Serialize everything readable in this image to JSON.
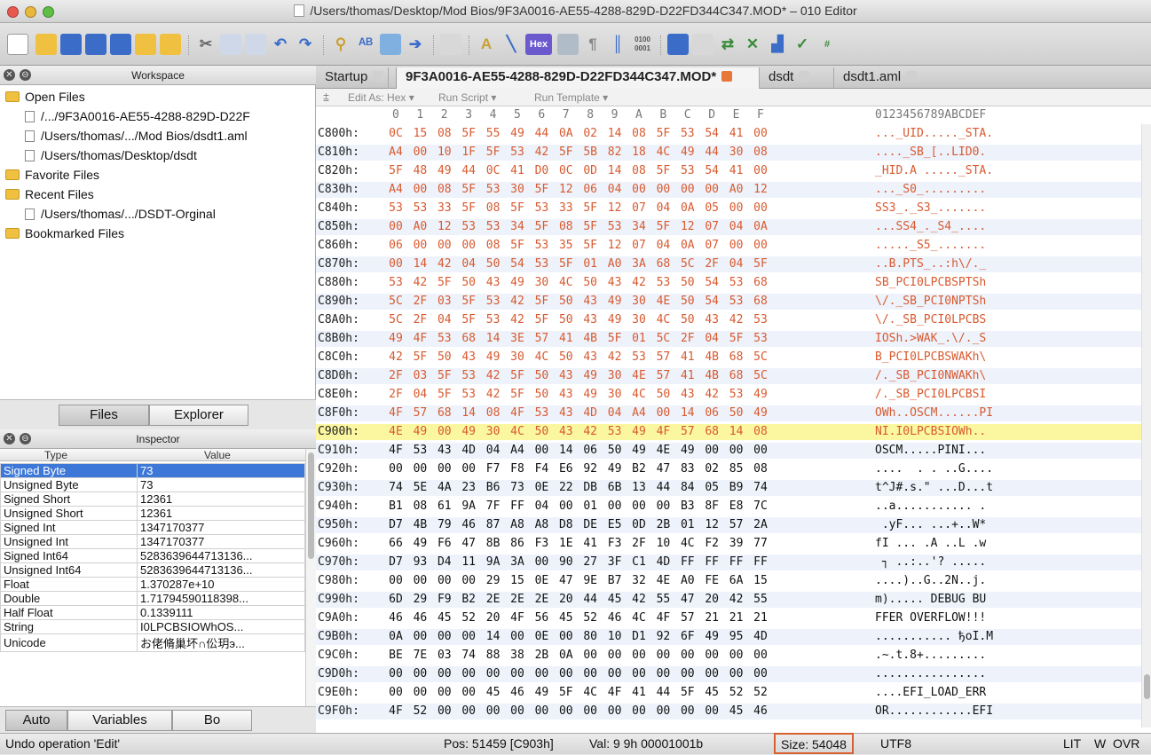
{
  "window": {
    "title": "/Users/thomas/Desktop/Mod Bios/9F3A0016-AE55-4288-829D-D22FD344C347.MOD* – 010 Editor"
  },
  "toolbar": {
    "icons": [
      "new-file-icon",
      "open-file-icon",
      "save-icon",
      "save-all-icon",
      "workspace-icon",
      "open-folder-icon",
      "folder-icon",
      "cut-icon",
      "copy-icon",
      "paste-icon",
      "undo-icon",
      "redo-icon",
      "find-icon",
      "replace-icon",
      "goto-icon",
      "arrow-icon",
      "print-icon",
      "font-icon",
      "highlight-icon",
      "hex-icon",
      "compare-icon",
      "paragraph-icon",
      "columns-icon",
      "binary-icon",
      "calculator-icon",
      "template-icon",
      "script-icon",
      "tools-icon",
      "histogram-icon",
      "checksum-icon",
      "convert-icon"
    ],
    "hex_label": "Hex",
    "binary_label": "0100\n0001"
  },
  "workspace": {
    "title": "Workspace",
    "open_files_label": "Open Files",
    "open_files": [
      "/.../9F3A0016-AE55-4288-829D-D22F",
      "/Users/thomas/.../Mod Bios/dsdt1.aml",
      "/Users/thomas/Desktop/dsdt"
    ],
    "favorite_label": "Favorite Files",
    "recent_label": "Recent Files",
    "recent_files": [
      "/Users/thomas/.../DSDT-Orginal"
    ],
    "bookmarked_label": "Bookmarked Files",
    "tabs": [
      "Files",
      "Explorer"
    ]
  },
  "inspector": {
    "title": "Inspector",
    "col_type": "Type",
    "col_value": "Value",
    "rows": [
      {
        "type": "Signed Byte",
        "value": "73"
      },
      {
        "type": "Unsigned Byte",
        "value": "73"
      },
      {
        "type": "Signed Short",
        "value": "12361"
      },
      {
        "type": "Unsigned Short",
        "value": "12361"
      },
      {
        "type": "Signed Int",
        "value": "1347170377"
      },
      {
        "type": "Unsigned Int",
        "value": "1347170377"
      },
      {
        "type": "Signed Int64",
        "value": "5283639644713136..."
      },
      {
        "type": "Unsigned Int64",
        "value": "5283639644713136..."
      },
      {
        "type": "Float",
        "value": "1.370287e+10"
      },
      {
        "type": "Double",
        "value": "1.71794590118398..."
      },
      {
        "type": "Half Float",
        "value": "0.1339111"
      },
      {
        "type": "String",
        "value": "I0LPCBSIOWhOS..."
      },
      {
        "type": "Unicode",
        "value": "お佬脩巢坏∩伀玥э..."
      }
    ],
    "tabs": [
      "Auto",
      "Variables",
      "Bo"
    ]
  },
  "editor": {
    "tabs": [
      "Startup",
      "9F3A0016-AE55-4288-829D-D22FD344C347.MOD*",
      "dsdt",
      "dsdt1.aml"
    ],
    "edit_as": "Edit As: Hex ▾",
    "run_script": "Run Script ▾",
    "run_template": "Run Template ▾",
    "col_headers": [
      "0",
      "1",
      "2",
      "3",
      "4",
      "5",
      "6",
      "7",
      "8",
      "9",
      "A",
      "B",
      "C",
      "D",
      "E",
      "F"
    ],
    "ascii_header": "0123456789ABCDEF",
    "rows": [
      {
        "addr": "C800h:",
        "bytes": [
          "0C",
          "15",
          "08",
          "5F",
          "55",
          "49",
          "44",
          "0A",
          "02",
          "14",
          "08",
          "5F",
          "53",
          "54",
          "41",
          "00"
        ],
        "ascii": "..._UID....._STA."
      },
      {
        "addr": "C810h:",
        "bytes": [
          "A4",
          "00",
          "10",
          "1F",
          "5F",
          "53",
          "42",
          "5F",
          "5B",
          "82",
          "18",
          "4C",
          "49",
          "44",
          "30",
          "08"
        ],
        "ascii": "...._SB_[..LID0."
      },
      {
        "addr": "C820h:",
        "bytes": [
          "5F",
          "48",
          "49",
          "44",
          "0C",
          "41",
          "D0",
          "0C",
          "0D",
          "14",
          "08",
          "5F",
          "53",
          "54",
          "41",
          "00"
        ],
        "ascii": "_HID.A ....._STA."
      },
      {
        "addr": "C830h:",
        "bytes": [
          "A4",
          "00",
          "08",
          "5F",
          "53",
          "30",
          "5F",
          "12",
          "06",
          "04",
          "00",
          "00",
          "00",
          "00",
          "A0",
          "12"
        ],
        "ascii": "..._S0_........."
      },
      {
        "addr": "C840h:",
        "bytes": [
          "53",
          "53",
          "33",
          "5F",
          "08",
          "5F",
          "53",
          "33",
          "5F",
          "12",
          "07",
          "04",
          "0A",
          "05",
          "00",
          "00"
        ],
        "ascii": "SS3_._S3_......."
      },
      {
        "addr": "C850h:",
        "bytes": [
          "00",
          "A0",
          "12",
          "53",
          "53",
          "34",
          "5F",
          "08",
          "5F",
          "53",
          "34",
          "5F",
          "12",
          "07",
          "04",
          "0A"
        ],
        "ascii": "...SS4_._S4_...."
      },
      {
        "addr": "C860h:",
        "bytes": [
          "06",
          "00",
          "00",
          "00",
          "08",
          "5F",
          "53",
          "35",
          "5F",
          "12",
          "07",
          "04",
          "0A",
          "07",
          "00",
          "00"
        ],
        "ascii": "....._S5_......."
      },
      {
        "addr": "C870h:",
        "bytes": [
          "00",
          "14",
          "42",
          "04",
          "50",
          "54",
          "53",
          "5F",
          "01",
          "A0",
          "3A",
          "68",
          "5C",
          "2F",
          "04",
          "5F"
        ],
        "ascii": "..B.PTS_..:h\\/._"
      },
      {
        "addr": "C880h:",
        "bytes": [
          "53",
          "42",
          "5F",
          "50",
          "43",
          "49",
          "30",
          "4C",
          "50",
          "43",
          "42",
          "53",
          "50",
          "54",
          "53",
          "68"
        ],
        "ascii": "SB_PCI0LPCBSPTSh"
      },
      {
        "addr": "C890h:",
        "bytes": [
          "5C",
          "2F",
          "03",
          "5F",
          "53",
          "42",
          "5F",
          "50",
          "43",
          "49",
          "30",
          "4E",
          "50",
          "54",
          "53",
          "68"
        ],
        "ascii": "\\/._SB_PCI0NPTSh"
      },
      {
        "addr": "C8A0h:",
        "bytes": [
          "5C",
          "2F",
          "04",
          "5F",
          "53",
          "42",
          "5F",
          "50",
          "43",
          "49",
          "30",
          "4C",
          "50",
          "43",
          "42",
          "53"
        ],
        "ascii": "\\/._SB_PCI0LPCBS"
      },
      {
        "addr": "C8B0h:",
        "bytes": [
          "49",
          "4F",
          "53",
          "68",
          "14",
          "3E",
          "57",
          "41",
          "4B",
          "5F",
          "01",
          "5C",
          "2F",
          "04",
          "5F",
          "53"
        ],
        "ascii": "IOSh.>WAK_.\\/._S"
      },
      {
        "addr": "C8C0h:",
        "bytes": [
          "42",
          "5F",
          "50",
          "43",
          "49",
          "30",
          "4C",
          "50",
          "43",
          "42",
          "53",
          "57",
          "41",
          "4B",
          "68",
          "5C"
        ],
        "ascii": "B_PCI0LPCBSWAKh\\"
      },
      {
        "addr": "C8D0h:",
        "bytes": [
          "2F",
          "03",
          "5F",
          "53",
          "42",
          "5F",
          "50",
          "43",
          "49",
          "30",
          "4E",
          "57",
          "41",
          "4B",
          "68",
          "5C"
        ],
        "ascii": "/._SB_PCI0NWAKh\\"
      },
      {
        "addr": "C8E0h:",
        "bytes": [
          "2F",
          "04",
          "5F",
          "53",
          "42",
          "5F",
          "50",
          "43",
          "49",
          "30",
          "4C",
          "50",
          "43",
          "42",
          "53",
          "49"
        ],
        "ascii": "/._SB_PCI0LPCBSI"
      },
      {
        "addr": "C8F0h:",
        "bytes": [
          "4F",
          "57",
          "68",
          "14",
          "08",
          "4F",
          "53",
          "43",
          "4D",
          "04",
          "A4",
          "00",
          "14",
          "06",
          "50",
          "49"
        ],
        "ascii": "OWh..OSCM......PI"
      },
      {
        "addr": "C900h:",
        "bytes": [
          "4E",
          "49",
          "00",
          "49",
          "30",
          "4C",
          "50",
          "43",
          "42",
          "53",
          "49",
          "4F",
          "57",
          "68",
          "14",
          "08"
        ],
        "ascii": "NI.I0LPCBSIOWh.."
      },
      {
        "addr": "C910h:",
        "bytes": [
          "4F",
          "53",
          "43",
          "4D",
          "04",
          "A4",
          "00",
          "14",
          "06",
          "50",
          "49",
          "4E",
          "49",
          "00",
          "00",
          "00"
        ],
        "ascii": "OSCM.....PINI..."
      },
      {
        "addr": "C920h:",
        "bytes": [
          "00",
          "00",
          "00",
          "00",
          "F7",
          "F8",
          "F4",
          "E6",
          "92",
          "49",
          "B2",
          "47",
          "83",
          "02",
          "85",
          "08"
        ],
        "ascii": "....  . . ..G...."
      },
      {
        "addr": "C930h:",
        "bytes": [
          "74",
          "5E",
          "4A",
          "23",
          "B6",
          "73",
          "0E",
          "22",
          "DB",
          "6B",
          "13",
          "44",
          "84",
          "05",
          "B9",
          "74"
        ],
        "ascii": "t^J#.s.\" ...D...t"
      },
      {
        "addr": "C940h:",
        "bytes": [
          "B1",
          "08",
          "61",
          "9A",
          "7F",
          "FF",
          "04",
          "00",
          "01",
          "00",
          "00",
          "00",
          "B3",
          "8F",
          "E8",
          "7C"
        ],
        "ascii": "..a........... ."
      },
      {
        "addr": "C950h:",
        "bytes": [
          "D7",
          "4B",
          "79",
          "46",
          "87",
          "A8",
          "A8",
          "D8",
          "DE",
          "E5",
          "0D",
          "2B",
          "01",
          "12",
          "57",
          "2A"
        ],
        "ascii": " .yF... ...+..W*"
      },
      {
        "addr": "C960h:",
        "bytes": [
          "66",
          "49",
          "F6",
          "47",
          "8B",
          "86",
          "F3",
          "1E",
          "41",
          "F3",
          "2F",
          "10",
          "4C",
          "F2",
          "39",
          "77"
        ],
        "ascii": "fI ... .A ..L .w"
      },
      {
        "addr": "C970h:",
        "bytes": [
          "D7",
          "93",
          "D4",
          "11",
          "9A",
          "3A",
          "00",
          "90",
          "27",
          "3F",
          "C1",
          "4D",
          "FF",
          "FF",
          "FF",
          "FF"
        ],
        "ascii": " ┐ ..:..'? ....."
      },
      {
        "addr": "C980h:",
        "bytes": [
          "00",
          "00",
          "00",
          "00",
          "29",
          "15",
          "0E",
          "47",
          "9E",
          "B7",
          "32",
          "4E",
          "A0",
          "FE",
          "6A",
          "15"
        ],
        "ascii": "....)..G..2N..j."
      },
      {
        "addr": "C990h:",
        "bytes": [
          "6D",
          "29",
          "F9",
          "B2",
          "2E",
          "2E",
          "2E",
          "20",
          "44",
          "45",
          "42",
          "55",
          "47",
          "20",
          "42",
          "55"
        ],
        "ascii": "m)..... DEBUG BU"
      },
      {
        "addr": "C9A0h:",
        "bytes": [
          "46",
          "46",
          "45",
          "52",
          "20",
          "4F",
          "56",
          "45",
          "52",
          "46",
          "4C",
          "4F",
          "57",
          "21",
          "21",
          "21"
        ],
        "ascii": "FFER OVERFLOW!!!"
      },
      {
        "addr": "C9B0h:",
        "bytes": [
          "0A",
          "00",
          "00",
          "00",
          "14",
          "00",
          "0E",
          "00",
          "80",
          "10",
          "D1",
          "92",
          "6F",
          "49",
          "95",
          "4D"
        ],
        "ascii": "........... ђoI.M"
      },
      {
        "addr": "C9C0h:",
        "bytes": [
          "BE",
          "7E",
          "03",
          "74",
          "88",
          "38",
          "2B",
          "0A",
          "00",
          "00",
          "00",
          "00",
          "00",
          "00",
          "00",
          "00"
        ],
        "ascii": ".~.t.8+........."
      },
      {
        "addr": "C9D0h:",
        "bytes": [
          "00",
          "00",
          "00",
          "00",
          "00",
          "00",
          "00",
          "00",
          "00",
          "00",
          "00",
          "00",
          "00",
          "00",
          "00",
          "00"
        ],
        "ascii": "................"
      },
      {
        "addr": "C9E0h:",
        "bytes": [
          "00",
          "00",
          "00",
          "00",
          "45",
          "46",
          "49",
          "5F",
          "4C",
          "4F",
          "41",
          "44",
          "5F",
          "45",
          "52",
          "52"
        ],
        "ascii": "....EFI_LOAD_ERR"
      },
      {
        "addr": "C9F0h:",
        "bytes": [
          "4F",
          "52",
          "00",
          "00",
          "00",
          "00",
          "00",
          "00",
          "00",
          "00",
          "00",
          "00",
          "00",
          "00",
          "45",
          "46",
          "49"
        ],
        "ascii": "OR............EFI"
      }
    ]
  },
  "statusbar": {
    "message": "Undo operation 'Edit'",
    "pos": "Pos: 51459 [C903h]",
    "val": "Val: 9 9h 00001001b",
    "size": "Size: 54048",
    "encoding": "UTF8",
    "endian": "LIT",
    "mode_w": "W",
    "mode_ovr": "OVR"
  },
  "colors": {
    "selection": "#3d78d8",
    "hex_orange": "#d85a30",
    "highlight": "#fbf7a0",
    "size_border": "#d86030"
  }
}
